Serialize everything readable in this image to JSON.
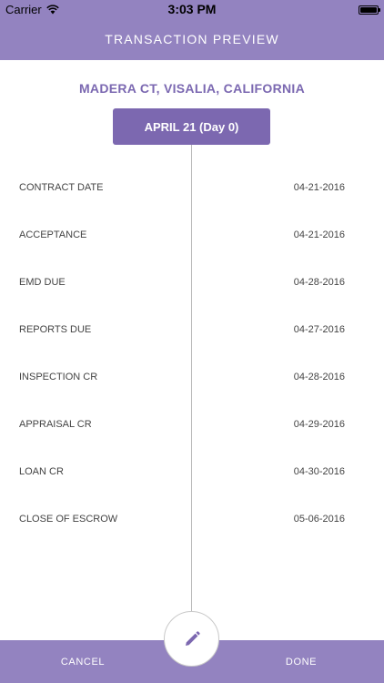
{
  "status_bar": {
    "carrier": "Carrier",
    "time": "3:03 PM"
  },
  "nav": {
    "title": "TRANSACTION PREVIEW"
  },
  "transaction": {
    "address": "MADERA CT, VISALIA, CALIFORNIA",
    "day_label": "APRIL 21 (Day 0)",
    "events": [
      {
        "label": "CONTRACT DATE",
        "date": "04-21-2016"
      },
      {
        "label": "ACCEPTANCE",
        "date": "04-21-2016"
      },
      {
        "label": "EMD DUE",
        "date": "04-28-2016"
      },
      {
        "label": "REPORTS DUE",
        "date": "04-27-2016"
      },
      {
        "label": "INSPECTION CR",
        "date": "04-28-2016"
      },
      {
        "label": "APPRAISAL CR",
        "date": "04-29-2016"
      },
      {
        "label": "LOAN CR",
        "date": "04-30-2016"
      },
      {
        "label": "CLOSE OF ESCROW",
        "date": "05-06-2016"
      }
    ]
  },
  "footer": {
    "cancel_label": "CANCEL",
    "done_label": "DONE"
  },
  "colors": {
    "header_bg": "#9383c0",
    "accent": "#7c68b0",
    "address_text": "#7b68b1"
  },
  "icons": {
    "edit": "pencil-icon",
    "wifi": "wifi-icon",
    "battery": "battery-icon"
  }
}
